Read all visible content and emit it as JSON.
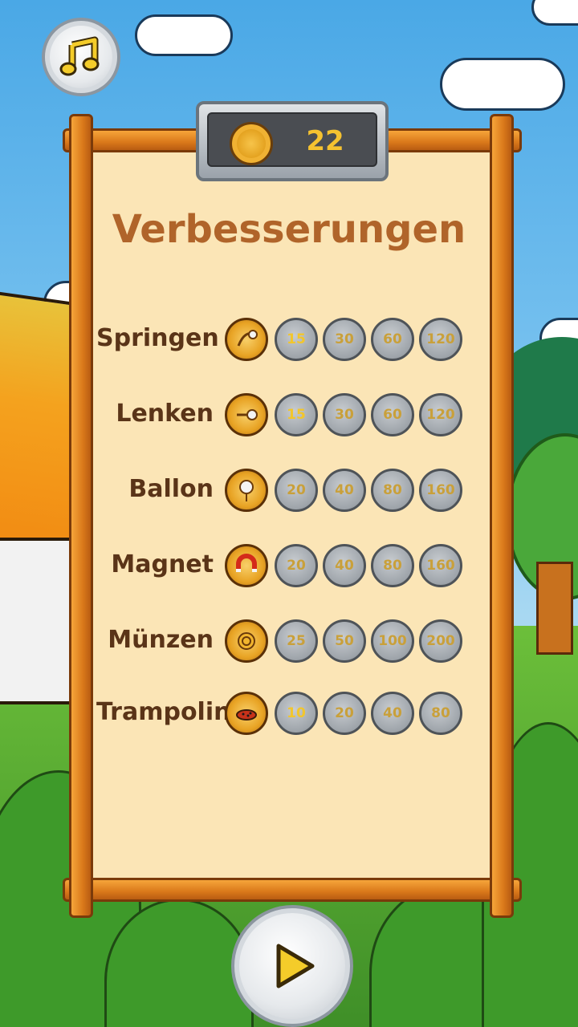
{
  "currency": {
    "coins": "22"
  },
  "title": "Verbesserungen",
  "upgrades": [
    {
      "label": "Springen",
      "icon": "jump-icon",
      "levels": [
        "15",
        "30",
        "60",
        "120"
      ]
    },
    {
      "label": "Lenken",
      "icon": "steer-icon",
      "levels": [
        "15",
        "30",
        "60",
        "120"
      ]
    },
    {
      "label": "Ballon",
      "icon": "balloon-icon",
      "levels": [
        "20",
        "40",
        "80",
        "160"
      ]
    },
    {
      "label": "Magnet",
      "icon": "magnet-icon",
      "levels": [
        "20",
        "40",
        "80",
        "160"
      ]
    },
    {
      "label": "Münzen",
      "icon": "coin-icon",
      "levels": [
        "25",
        "50",
        "100",
        "200"
      ]
    },
    {
      "label": "Trampolin",
      "icon": "trampoline-icon",
      "levels": [
        "10",
        "20",
        "40",
        "80"
      ]
    }
  ],
  "colors": {
    "board": "#fbe5b6",
    "wood": "#d9781a",
    "title": "#b0642a",
    "label": "#5a3418",
    "coin_gold": "#f5c230",
    "sky": "#4aa8e6"
  },
  "buttons": {
    "music": "music-note-icon",
    "play": "play-icon"
  }
}
